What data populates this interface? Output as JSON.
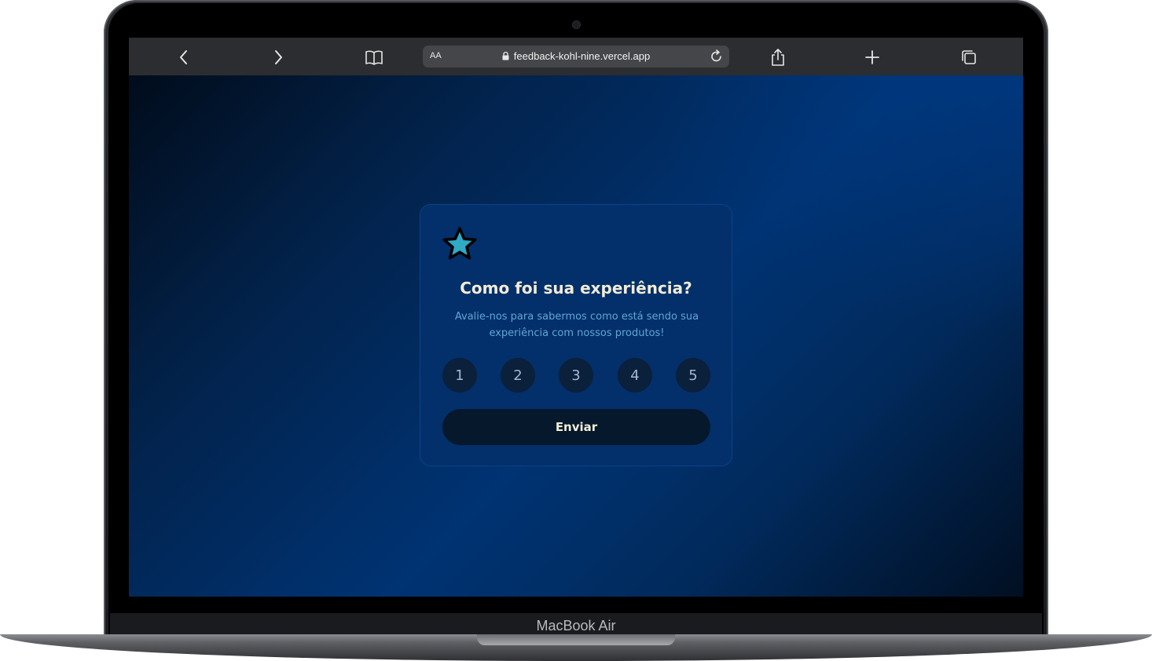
{
  "device": {
    "label": "MacBook Air"
  },
  "browser": {
    "url": "feedback-kohl-nine.vercel.app",
    "reader_label": "AA",
    "icons": {
      "back": "chevron-left-icon",
      "forward": "chevron-right-icon",
      "bookmarks": "book-icon",
      "lock": "lock-icon",
      "reload": "reload-icon",
      "share": "share-icon",
      "new_tab": "plus-icon",
      "tabs": "tabs-icon"
    }
  },
  "card": {
    "icon": "star-icon",
    "title": "Como foi sua experiência?",
    "description": "Avalie-nos para sabermos como está sendo sua experiência com nossos produtos!",
    "ratings": [
      "1",
      "2",
      "3",
      "4",
      "5"
    ],
    "submit_label": "Enviar"
  },
  "colors": {
    "card_bg": "#032f6a",
    "title": "#f2ecd6",
    "description": "#5fa7d4",
    "rating_bg": "#0a203b",
    "star_fill": "#2fa9c4",
    "button_bg": "#05182c"
  }
}
